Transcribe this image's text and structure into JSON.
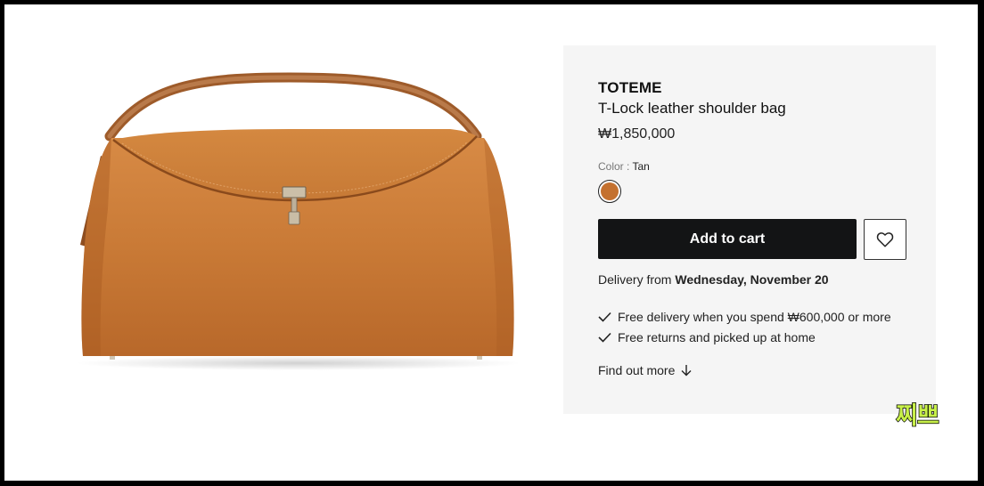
{
  "product": {
    "brand": "TOTEME",
    "name": "T-Lock leather shoulder bag",
    "price": "₩1,850,000",
    "color_label": "Color : ",
    "color_value": "Tan",
    "swatch_color": "#c4712f",
    "add_to_cart_label": "Add to cart",
    "wishlist_icon": "heart-icon"
  },
  "delivery": {
    "prefix": "Delivery from ",
    "date": "Wednesday, November 20"
  },
  "perks": [
    {
      "icon": "check-icon",
      "text": "Free delivery when you spend ₩600,000 or more"
    },
    {
      "icon": "check-icon",
      "text": "Free returns and picked up at home"
    }
  ],
  "find_out_more": "Find out more",
  "watermark": "찌쁘",
  "colors": {
    "button_bg": "#131415",
    "panel_bg": "#f5f5f5",
    "leather": "#c4712f"
  }
}
